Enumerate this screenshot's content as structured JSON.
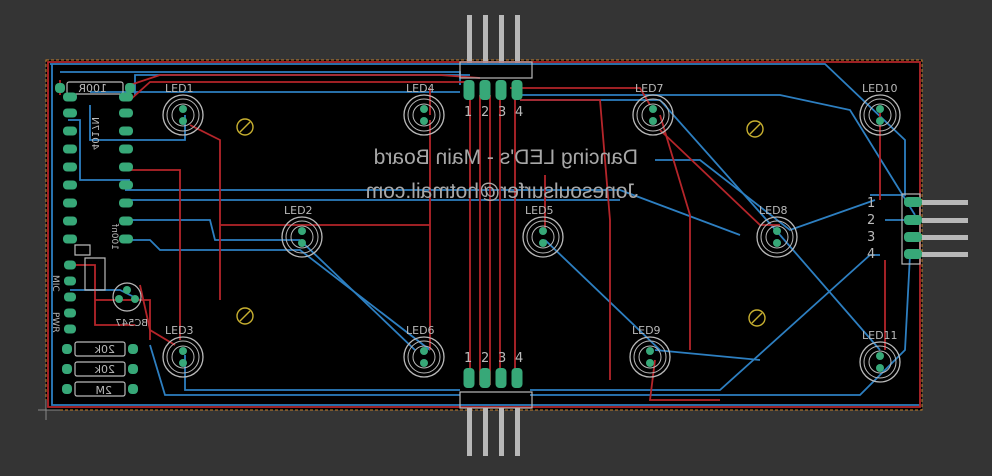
{
  "board": {
    "title_line1": "Dancing LED's - Main Board",
    "title_line2": "Jonesoulsurfer@hotmail.com"
  },
  "components": {
    "leds": [
      {
        "label": "LED1"
      },
      {
        "label": "LED2"
      },
      {
        "label": "LED3"
      },
      {
        "label": "LED4"
      },
      {
        "label": "LED5"
      },
      {
        "label": "LED6"
      },
      {
        "label": "LED7"
      },
      {
        "label": "LED8"
      },
      {
        "label": "LED9"
      },
      {
        "label": "LED10"
      },
      {
        "label": "LED11"
      }
    ],
    "resistor_100r": "100R",
    "resistor_20k_a": "20k",
    "resistor_20k_b": "20k",
    "resistor_2m": "2M",
    "ic_label": "4017N",
    "capacitor_label": "100nf",
    "transistor_label": "BC547",
    "mic_label": "MIC",
    "pwr_label": "PWR"
  },
  "connectors": {
    "top_pins": [
      "1",
      "2",
      "3",
      "4"
    ],
    "bottom_pins": [
      "1",
      "2",
      "3",
      "4"
    ],
    "right_pins": [
      "1",
      "2",
      "3",
      "4"
    ]
  },
  "colors": {
    "background": "#343434",
    "board": "#000000",
    "outline": "#c8822b",
    "top_copper": "#b5252a",
    "bottom_copper": "#2d7fc1",
    "pads": "#37a878",
    "silkscreen": "#b9b9b9",
    "mount_hole": "#c8b030"
  }
}
